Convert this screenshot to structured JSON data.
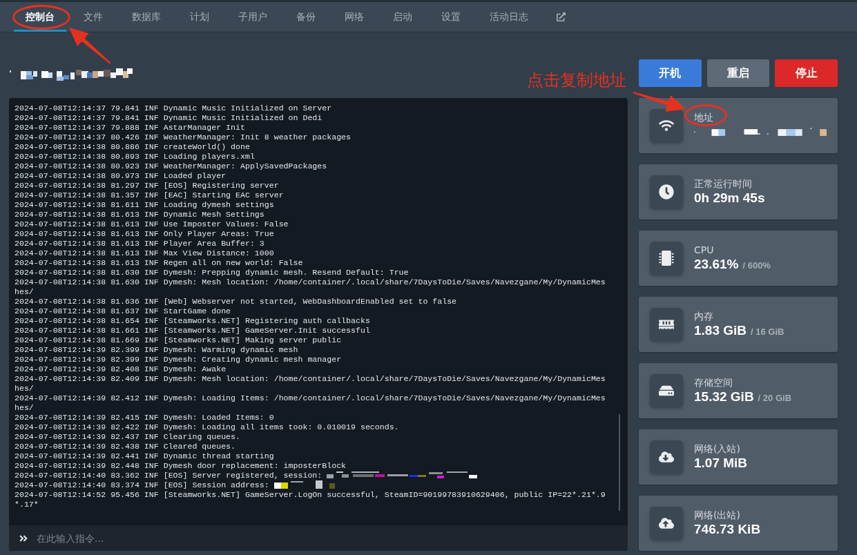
{
  "nav": {
    "tabs": [
      {
        "label": "控制台",
        "selected": true,
        "circled": true
      },
      {
        "label": "文件",
        "selected": false,
        "circled": false
      },
      {
        "label": "数据库",
        "selected": false,
        "circled": false
      },
      {
        "label": "计划",
        "selected": false,
        "circled": false
      },
      {
        "label": "子用户",
        "selected": false,
        "circled": false
      },
      {
        "label": "备份",
        "selected": false,
        "circled": false
      },
      {
        "label": "网络",
        "selected": false,
        "circled": false
      },
      {
        "label": "启动",
        "selected": false,
        "circled": false
      },
      {
        "label": "设置",
        "selected": false,
        "circled": false
      },
      {
        "label": "活动日志",
        "selected": false,
        "circled": false
      }
    ]
  },
  "server": {
    "name_redacted": true
  },
  "power_buttons": [
    {
      "label": "开机",
      "kind": "start"
    },
    {
      "label": "重启",
      "kind": "restart"
    },
    {
      "label": "停止",
      "kind": "stop"
    }
  ],
  "console": {
    "lines": [
      {
        "text": "2024-07-08T12:14:37 79.841 INF Dynamic Music Initialized on Server",
        "redacted": false
      },
      {
        "text": "2024-07-08T12:14:37 79.841 INF Dynamic Music Initialized on Dedi",
        "redacted": false
      },
      {
        "text": "2024-07-08T12:14:37 79.888 INF AstarManager Init",
        "redacted": false
      },
      {
        "text": "2024-07-08T12:14:37 80.426 INF WeatherManager: Init 8 weather packages",
        "redacted": false
      },
      {
        "text": "2024-07-08T12:14:38 80.886 INF createWorld() done",
        "redacted": false
      },
      {
        "text": "2024-07-08T12:14:38 80.893 INF Loading players.xml",
        "redacted": false
      },
      {
        "text": "2024-07-08T12:14:38 80.923 INF WeatherManager: ApplySavedPackages",
        "redacted": false
      },
      {
        "text": "2024-07-08T12:14:38 80.973 INF Loaded player",
        "redacted": false
      },
      {
        "text": "2024-07-08T12:14:38 81.297 INF [EOS] Registering server",
        "redacted": false
      },
      {
        "text": "2024-07-08T12:14:38 81.357 INF [EAC] Starting EAC server",
        "redacted": false
      },
      {
        "text": "2024-07-08T12:14:38 81.611 INF Loading dymesh settings",
        "redacted": false
      },
      {
        "text": "2024-07-08T12:14:38 81.613 INF Dynamic Mesh Settings",
        "redacted": false
      },
      {
        "text": "2024-07-08T12:14:38 81.613 INF Use Imposter Values: False",
        "redacted": false
      },
      {
        "text": "2024-07-08T12:14:38 81.613 INF Only Player Areas: True",
        "redacted": false
      },
      {
        "text": "2024-07-08T12:14:38 81.613 INF Player Area Buffer: 3",
        "redacted": false
      },
      {
        "text": "2024-07-08T12:14:38 81.613 INF Max View Distance: 1000",
        "redacted": false
      },
      {
        "text": "2024-07-08T12:14:38 81.613 INF Regen all on new world: False",
        "redacted": false
      },
      {
        "text": "2024-07-08T12:14:38 81.630 INF Dymesh: Prepping dynamic mesh. Resend Default: True",
        "redacted": false
      },
      {
        "text": "2024-07-08T12:14:38 81.630 INF Dymesh: Mesh location: /home/container/.local/share/7DaysToDie/Saves/Navezgane/My/DynamicMeshes/",
        "redacted": false
      },
      {
        "text": "2024-07-08T12:14:38 81.636 INF [Web] Webserver not started, WebDashboardEnabled set to false",
        "redacted": false
      },
      {
        "text": "2024-07-08T12:14:38 81.637 INF StartGame done",
        "redacted": false
      },
      {
        "text": "2024-07-08T12:14:38 81.654 INF [Steamworks.NET] Registering auth callbacks",
        "redacted": false
      },
      {
        "text": "2024-07-08T12:14:38 81.661 INF [Steamworks.NET] GameServer.Init successful",
        "redacted": false
      },
      {
        "text": "2024-07-08T12:14:38 81.669 INF [Steamworks.NET] Making server public",
        "redacted": false
      },
      {
        "text": "2024-07-08T12:14:39 82.399 INF Dymesh: Warming dynamic mesh",
        "redacted": false
      },
      {
        "text": "2024-07-08T12:14:39 82.399 INF Dymesh: Creating dynamic mesh manager",
        "redacted": false
      },
      {
        "text": "2024-07-08T12:14:39 82.408 INF Dymesh: Awake",
        "redacted": false
      },
      {
        "text": "2024-07-08T12:14:39 82.409 INF Dymesh: Mesh location: /home/container/.local/share/7DaysToDie/Saves/Navezgane/My/DynamicMeshes/",
        "redacted": false
      },
      {
        "text": "2024-07-08T12:14:39 82.412 INF Dymesh: Loading Items: /home/container/.local/share/7DaysToDie/Saves/Navezgane/My/DynamicMeshes/",
        "redacted": false
      },
      {
        "text": "2024-07-08T12:14:39 82.415 INF Dymesh: Loaded Items: 0",
        "redacted": false
      },
      {
        "text": "2024-07-08T12:14:39 82.422 INF Dymesh: Loading all items took: 0.010019 seconds.",
        "redacted": false
      },
      {
        "text": "2024-07-08T12:14:39 82.437 INF Clearing queues.",
        "redacted": false
      },
      {
        "text": "2024-07-08T12:14:39 82.438 INF Cleared queues.",
        "redacted": false
      },
      {
        "text": "2024-07-08T12:14:39 82.441 INF Dynamic thread starting",
        "redacted": false
      },
      {
        "text": "2024-07-08T12:14:39 82.448 INF Dymesh door replacement: imposterBlock",
        "redacted": false
      },
      {
        "text": "2024-07-08T12:14:40 83.362 INF [EOS] Server registered, session:",
        "redacted": true
      },
      {
        "text": "2024-07-08T12:14:40 83.374 INF [EOS] Session address:",
        "redacted": true
      },
      {
        "text": "2024-07-08T12:14:52 95.456 INF [Steamworks.NET] GameServer.LogOn successful, SteamID=90199783910629406, public IP=22*.21*.9*.17*",
        "redacted": false
      }
    ],
    "input": {
      "placeholder": "在此输入指令..."
    }
  },
  "stats": [
    {
      "label": "地址",
      "value_redacted": true,
      "circled": true,
      "callout": "点击复制地址"
    },
    {
      "label": "正常运行时间",
      "value": "0h 29m 45s",
      "circled": false
    },
    {
      "label": "CPU",
      "value": "23.61%",
      "limit": "/ 600%",
      "circled": false
    },
    {
      "label": "内存",
      "value": "1.83 GiB",
      "limit": "/ 16 GiB",
      "circled": false
    },
    {
      "label": "存储空间",
      "value": "15.32 GiB",
      "limit": "/ 20 GiB",
      "circled": false
    },
    {
      "label": "网络(入站)",
      "value": "1.07 MiB",
      "circled": false
    },
    {
      "label": "网络(出站)",
      "value": "746.73 KiB",
      "circled": false
    }
  ]
}
